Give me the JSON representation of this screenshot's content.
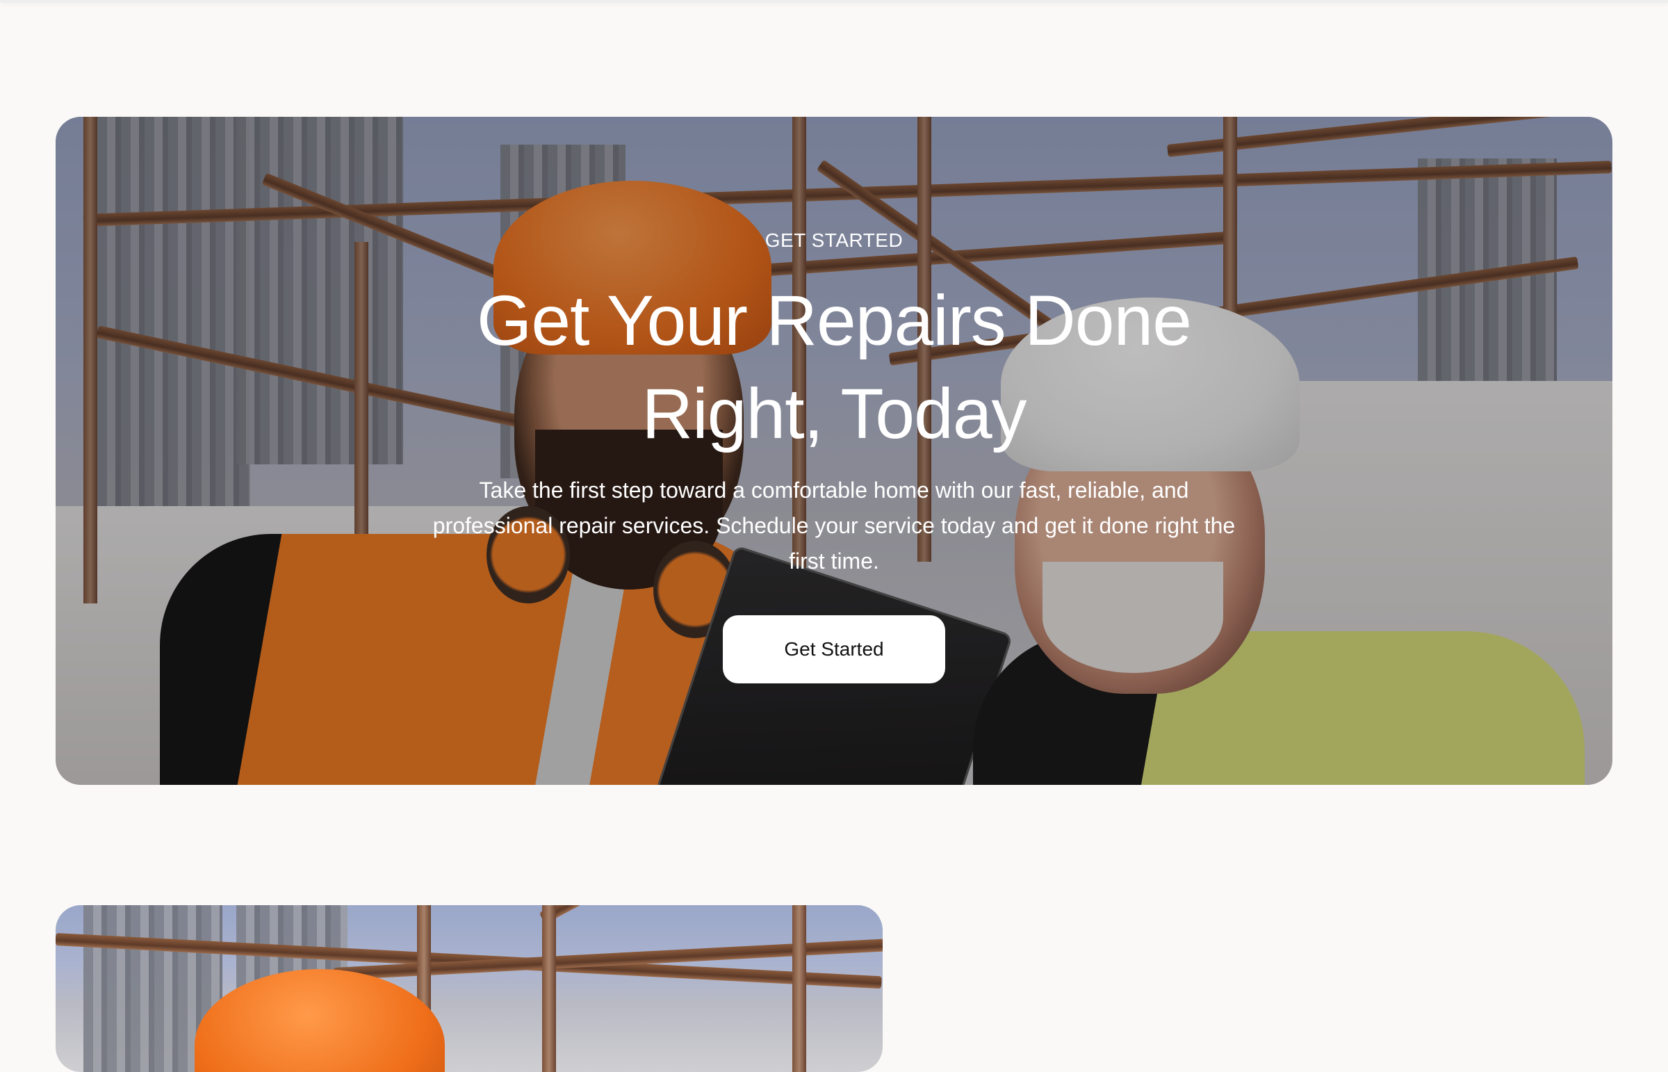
{
  "hero": {
    "eyebrow": "GET STARTED",
    "headline": "Get Your Repairs Done Right, Today",
    "subtext": "Take the first step toward a comfortable home with our fast, reliable, and professional repair services. Schedule your service today and get it done right the first time.",
    "cta_label": "Get Started",
    "image_icon": "construction-workers-photo"
  },
  "card2": {
    "image_icon": "construction-workers-photo"
  },
  "colors": {
    "page_background": "#faf9f7",
    "cta_background": "#ffffff",
    "cta_text": "#121212",
    "hero_text": "#ffffff",
    "hardhat_orange": "#ef6f1a",
    "hardhat_white": "#eeeeee",
    "vest_yellow": "#d8e07a"
  }
}
